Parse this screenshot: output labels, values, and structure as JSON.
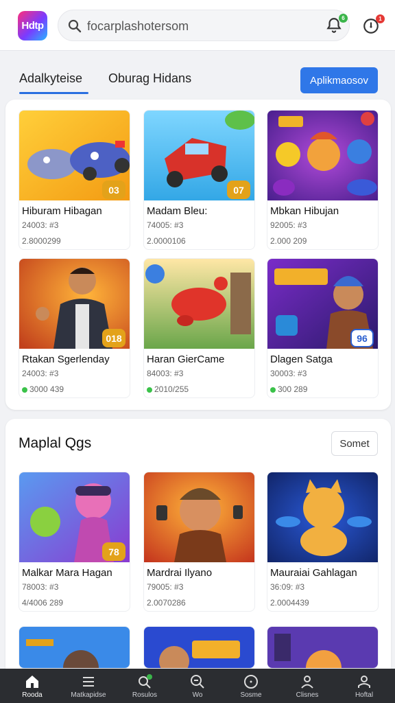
{
  "header": {
    "logo_text": "Hdtp",
    "search_placeholder": "focarplashotersom",
    "notification_badge": "6",
    "alert_badge": "1",
    "colors": {
      "notification": "#3bb54a",
      "alert": "#e53935",
      "accent": "#2f77e8"
    }
  },
  "tabs": [
    {
      "label": "Adalkyteise",
      "active": true
    },
    {
      "label": "Oburag Hidans",
      "active": false
    }
  ],
  "primary_button": "Aplikmaosov",
  "featured": {
    "cards": [
      {
        "title": "Hiburam Hibagan",
        "meta": "24003: #3",
        "stat": "2.8000299",
        "rank": "03",
        "icon": "toy-vehicles-thumbnail",
        "online": false
      },
      {
        "title": "Madam Bleu:",
        "meta": "74005: #3",
        "stat": "2.0000106",
        "rank": "07",
        "icon": "red-car-thumbnail",
        "online": false
      },
      {
        "title": "Mbkan Hibujan",
        "meta": "92005: #3",
        "stat": "2.000 209",
        "rank": "",
        "icon": "candy-characters-thumbnail",
        "online": false
      },
      {
        "title": "Rtakan Sgerlenday",
        "meta": "24003: #3",
        "stat": "3000 439",
        "rank": "018",
        "icon": "hero-character-thumbnail",
        "online": true
      },
      {
        "title": "Haran GierCame",
        "meta": "84003: #3",
        "stat": "2010/255",
        "rank": "",
        "icon": "red-creature-thumbnail",
        "online": true
      },
      {
        "title": "Dlagen Satga",
        "meta": "30003: #3",
        "stat": "300 289",
        "rank": "96",
        "icon": "warrior-thumbnail",
        "online": true
      }
    ]
  },
  "section": {
    "title": "Maplal Qgs",
    "more_label": "Somet",
    "cards": [
      {
        "title": "Malkar Mara Hagan",
        "meta": "78003: #3",
        "stat": "4/4006 289",
        "rank": "78",
        "icon": "monster-goggles-thumbnail"
      },
      {
        "title": "Mardrai Ilyano",
        "meta": "79005: #3",
        "stat": "2.0070286",
        "rank": "",
        "icon": "cat-miner-thumbnail"
      },
      {
        "title": "Mauraiai Gahlagan",
        "meta": "36:09: #3",
        "stat": "2.0004439",
        "rank": "",
        "icon": "flying-cat-thumbnail"
      }
    ]
  },
  "bottom_nav": [
    {
      "label": "Rooda",
      "icon": "home-icon",
      "active": true
    },
    {
      "label": "Matkapidse",
      "icon": "list-icon",
      "active": false
    },
    {
      "label": "Rosulos",
      "icon": "search-badge-icon",
      "active": false
    },
    {
      "label": "Wo",
      "icon": "zoom-icon",
      "active": false
    },
    {
      "label": "Sosme",
      "icon": "compass-icon",
      "active": false
    },
    {
      "label": "Clisnes",
      "icon": "person-icon",
      "active": false
    },
    {
      "label": "Hoftal",
      "icon": "profile-icon",
      "active": false
    }
  ]
}
